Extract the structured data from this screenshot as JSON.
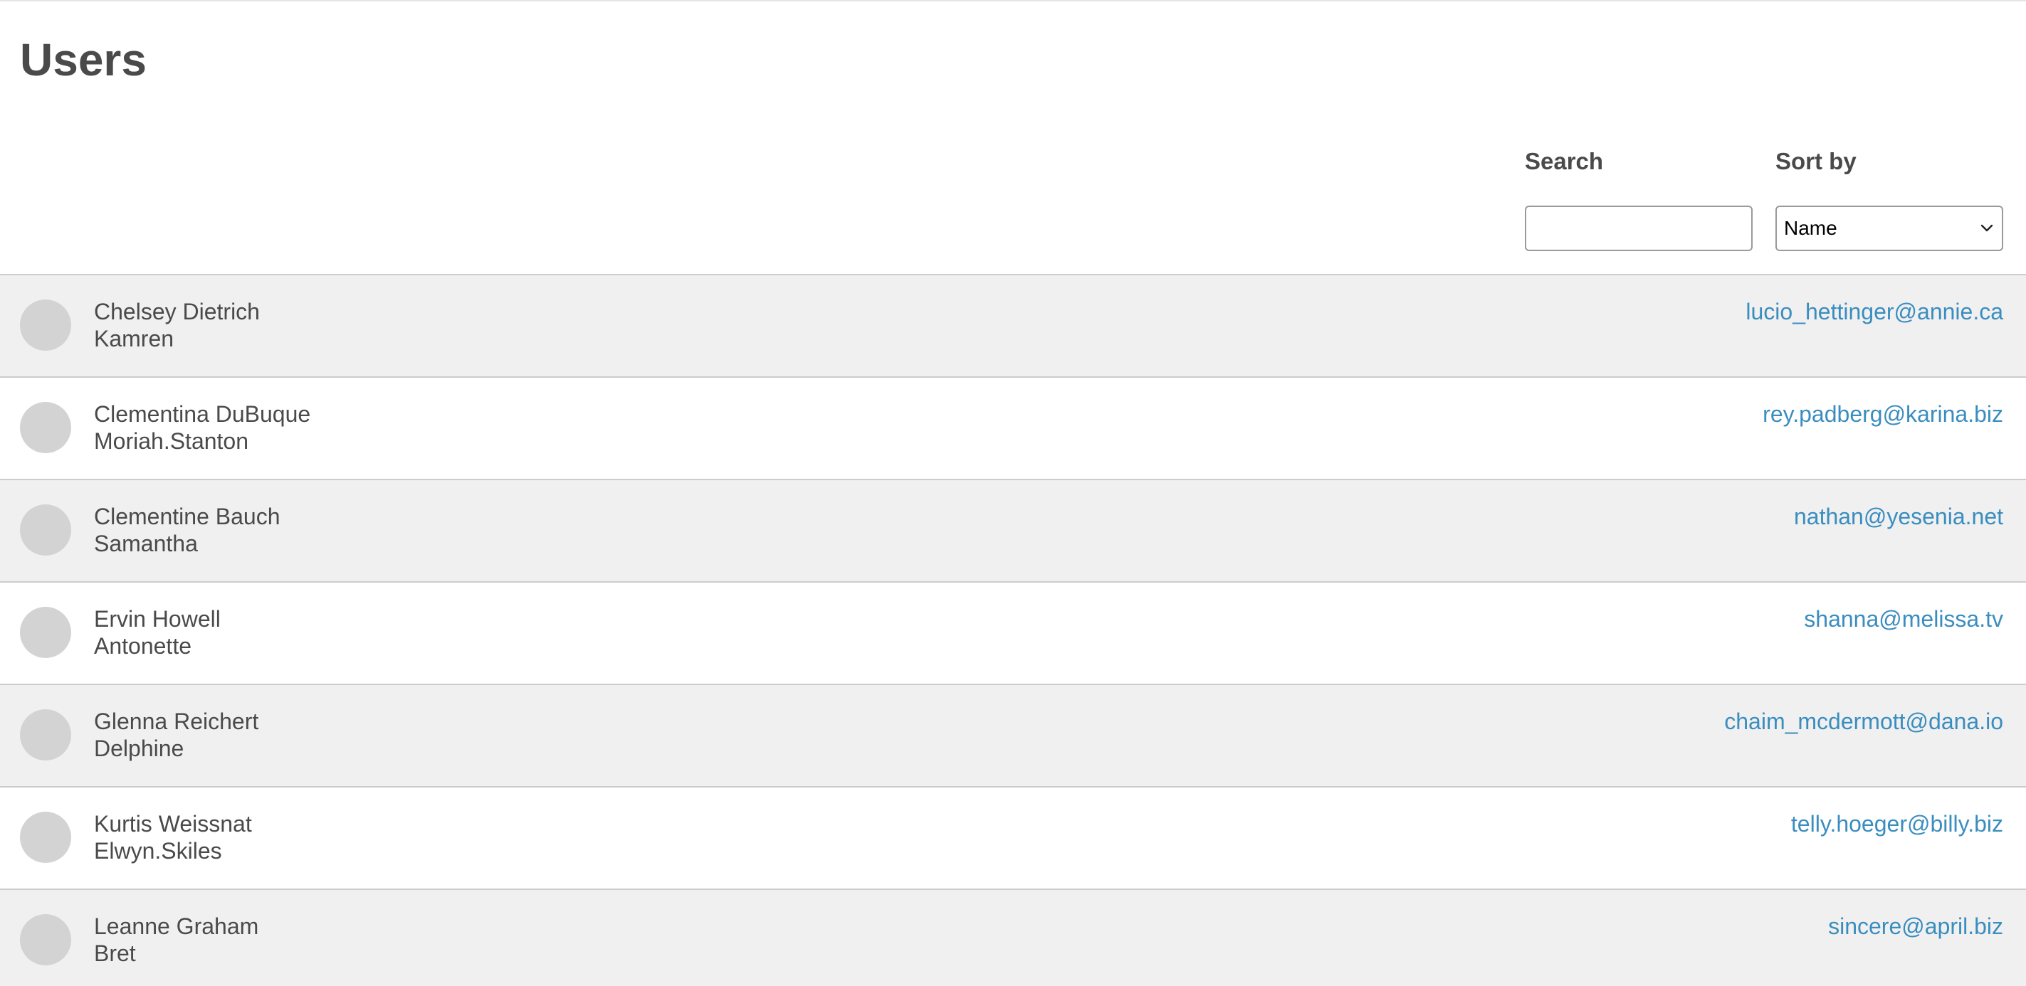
{
  "header": {
    "title": "Users"
  },
  "controls": {
    "search_label": "Search",
    "search_value": "",
    "sort_label": "Sort by",
    "sort_value": "Name"
  },
  "icons": {
    "sort_select": "chevron-down-icon"
  },
  "colors": {
    "link": "#3a8dbf",
    "row_alt": "#f0f0f0",
    "avatar": "#d3d3d3"
  },
  "users": [
    {
      "name": "Chelsey Dietrich",
      "username": "Kamren",
      "email": "lucio_hettinger@annie.ca"
    },
    {
      "name": "Clementina DuBuque",
      "username": "Moriah.Stanton",
      "email": "rey.padberg@karina.biz"
    },
    {
      "name": "Clementine Bauch",
      "username": "Samantha",
      "email": "nathan@yesenia.net"
    },
    {
      "name": "Ervin Howell",
      "username": "Antonette",
      "email": "shanna@melissa.tv"
    },
    {
      "name": "Glenna Reichert",
      "username": "Delphine",
      "email": "chaim_mcdermott@dana.io"
    },
    {
      "name": "Kurtis Weissnat",
      "username": "Elwyn.Skiles",
      "email": "telly.hoeger@billy.biz"
    },
    {
      "name": "Leanne Graham",
      "username": "Bret",
      "email": "sincere@april.biz"
    }
  ]
}
